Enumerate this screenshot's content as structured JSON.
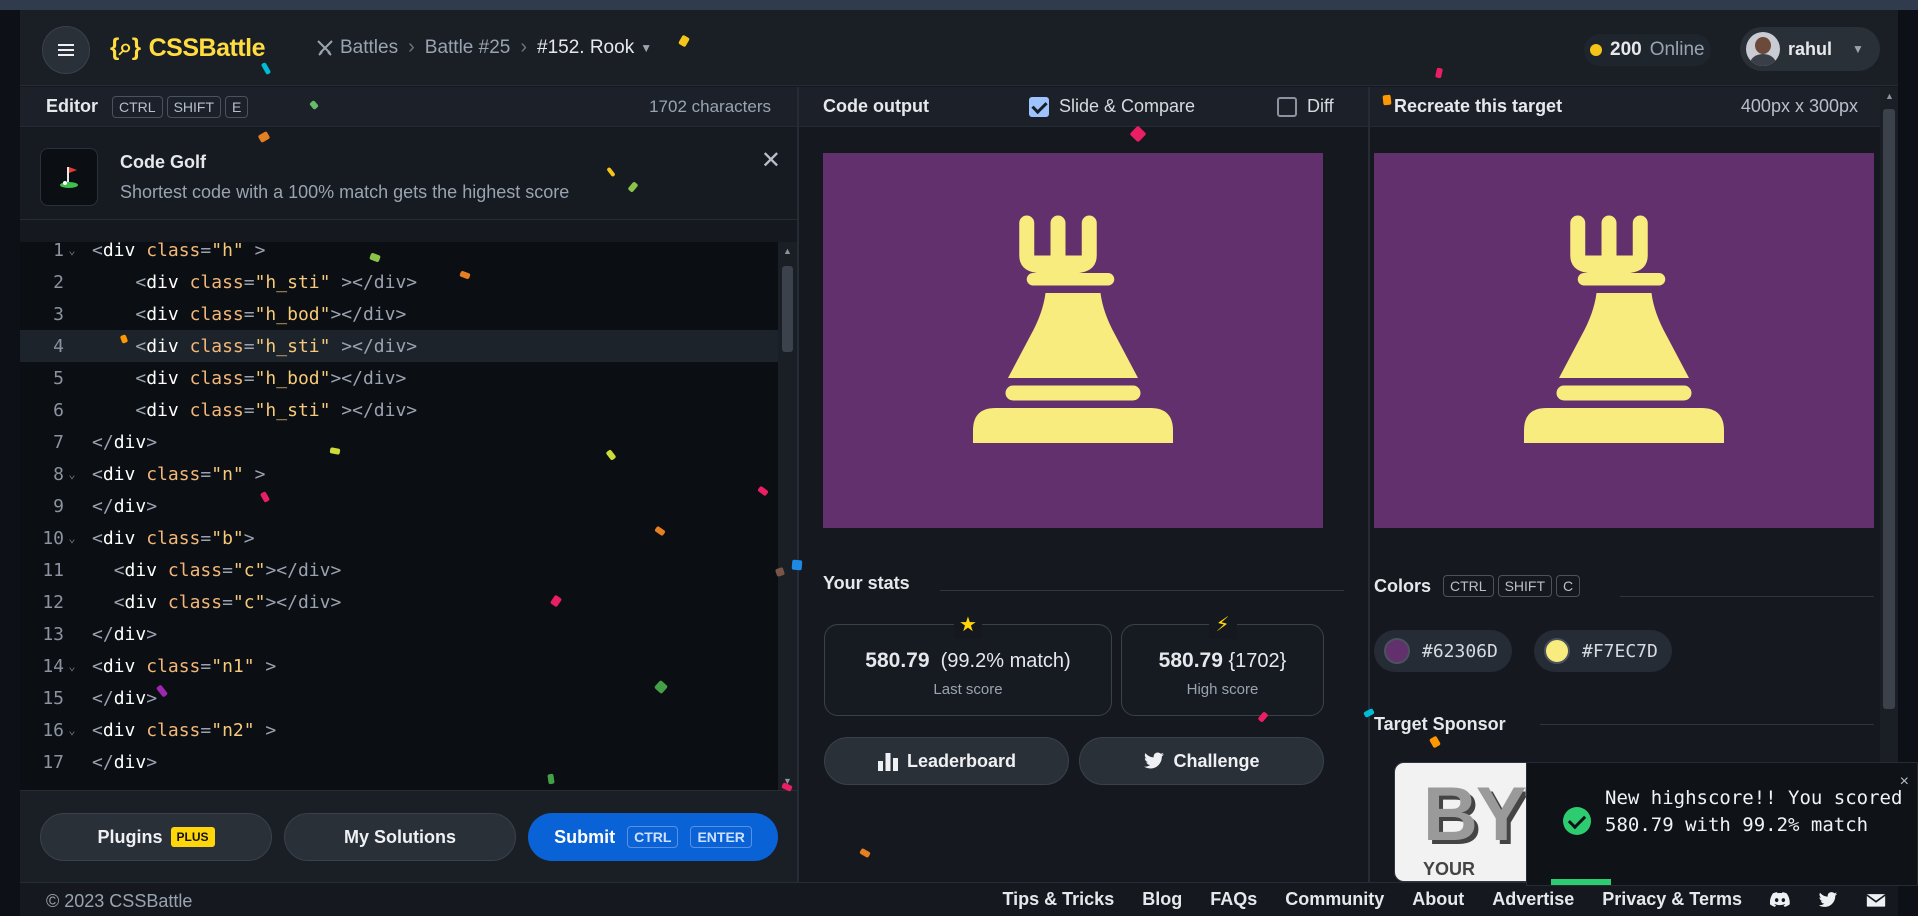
{
  "header": {
    "logo_text": "CSSBattle",
    "logo_mark": "{⌕}",
    "breadcrumb": [
      "Battles",
      "Battle #25",
      "#152. Rook"
    ],
    "online_count": "200",
    "online_label": "Online",
    "username": "rahul"
  },
  "editor": {
    "title": "Editor",
    "shortcut": [
      "CTRL",
      "SHIFT",
      "E"
    ],
    "char_count": "1702 characters",
    "golf_title": "Code Golf",
    "golf_desc": "Shortest code with a 100% match gets the highest score",
    "active_line": 4,
    "lines": [
      {
        "n": "1",
        "fold": true,
        "indent": "",
        "tag": "div",
        "attr": "class",
        "val": "\"h\"",
        "tail": " >",
        "close": false
      },
      {
        "n": "2",
        "fold": false,
        "indent": "    ",
        "tag": "div",
        "attr": "class",
        "val": "\"h_sti\"",
        "tail": " ></div>",
        "close": false
      },
      {
        "n": "3",
        "fold": false,
        "indent": "    ",
        "tag": "div",
        "attr": "class",
        "val": "\"h_bod\"",
        "tail": "></div>",
        "close": false
      },
      {
        "n": "4",
        "fold": false,
        "indent": "    ",
        "tag": "div",
        "attr": "class",
        "val": "\"h_sti\"",
        "tail": " ></div>",
        "close": false
      },
      {
        "n": "5",
        "fold": false,
        "indent": "    ",
        "tag": "div",
        "attr": "class",
        "val": "\"h_bod\"",
        "tail": "></div>",
        "close": false
      },
      {
        "n": "6",
        "fold": false,
        "indent": "    ",
        "tag": "div",
        "attr": "class",
        "val": "\"h_sti\"",
        "tail": " ></div>",
        "close": false
      },
      {
        "n": "7",
        "fold": false,
        "indent": "",
        "tag": "div",
        "close": true
      },
      {
        "n": "8",
        "fold": true,
        "indent": "",
        "tag": "div",
        "attr": "class",
        "val": "\"n\"",
        "tail": " >",
        "close": false
      },
      {
        "n": "9",
        "fold": false,
        "indent": "",
        "tag": "div",
        "close": true
      },
      {
        "n": "10",
        "fold": true,
        "indent": "",
        "tag": "div",
        "attr": "class",
        "val": "\"b\"",
        "tail": ">",
        "close": false
      },
      {
        "n": "11",
        "fold": false,
        "indent": "  ",
        "tag": "div",
        "attr": "class",
        "val": "\"c\"",
        "tail": "></div>",
        "close": false
      },
      {
        "n": "12",
        "fold": false,
        "indent": "  ",
        "tag": "div",
        "attr": "class",
        "val": "\"c\"",
        "tail": "></div>",
        "close": false
      },
      {
        "n": "13",
        "fold": false,
        "indent": "",
        "tag": "div",
        "close": true
      },
      {
        "n": "14",
        "fold": true,
        "indent": "",
        "tag": "div",
        "attr": "class",
        "val": "\"n1\"",
        "tail": " >",
        "close": false
      },
      {
        "n": "15",
        "fold": false,
        "indent": "",
        "tag": "div",
        "close": true
      },
      {
        "n": "16",
        "fold": true,
        "indent": "",
        "tag": "div",
        "attr": "class",
        "val": "\"n2\"",
        "tail": " >",
        "close": false
      },
      {
        "n": "17",
        "fold": false,
        "indent": "",
        "tag": "div",
        "close": true
      }
    ],
    "buttons": {
      "plugins": "Plugins",
      "plus_badge": "PLUS",
      "solutions": "My Solutions",
      "submit": "Submit",
      "submit_keys": [
        "CTRL",
        "ENTER"
      ]
    }
  },
  "output": {
    "title": "Code output",
    "slide_compare": "Slide & Compare",
    "slide_compare_checked": true,
    "diff": "Diff",
    "diff_checked": false,
    "stats_title": "Your stats",
    "last_score": "580.79",
    "last_match": "(99.2% match)",
    "last_label": "Last score",
    "high_score": "580.79",
    "high_chars": "{1702}",
    "high_label": "High score",
    "leaderboard": "Leaderboard",
    "challenge": "Challenge"
  },
  "target": {
    "title": "Recreate this target",
    "dims": "400px x 300px",
    "colors_title": "Colors",
    "colors_shortcut": [
      "CTRL",
      "SHIFT",
      "C"
    ],
    "colors": [
      {
        "hex": "#62306D"
      },
      {
        "hex": "#F7EC7D"
      }
    ],
    "sponsor_title": "Target Sponsor",
    "sponsor_logo": "BYT",
    "sponsor_tag": "YOUR"
  },
  "toast": {
    "message": "New highscore!! You scored 580.79 with 99.2% match",
    "close": "×"
  },
  "footer": {
    "copyright": "© 2023 CSSBattle",
    "links": [
      "Tips & Tricks",
      "Blog",
      "FAQs",
      "Community",
      "About",
      "Advertise",
      "Privacy & Terms"
    ]
  },
  "colors": {
    "accent": "#ffdd40",
    "bg": "#15191f",
    "submit": "#0a63d6",
    "canvas_bg": "#62306D",
    "rook": "#F7EC7D"
  }
}
